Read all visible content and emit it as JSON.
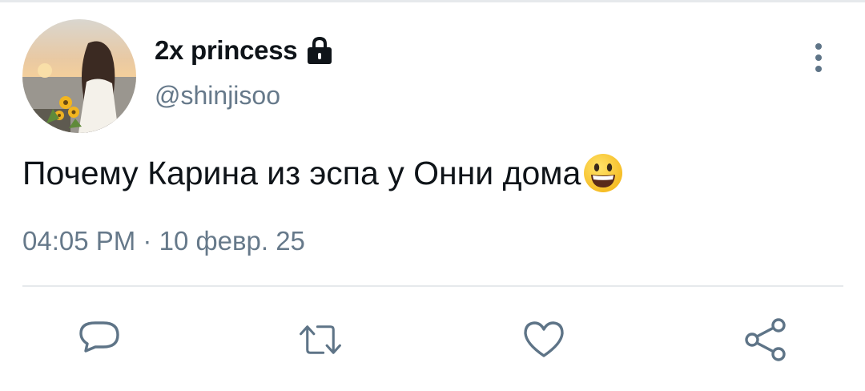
{
  "author": {
    "display_name": "2x princess",
    "handle": "@shinjisoo",
    "avatar": "avatar-photo-girl-sunflowers-sea",
    "lock_icon": "lock-icon"
  },
  "tweet": {
    "text": "Почему Карина из эспа у Онни дома",
    "emoji": "smiling-face-emoji",
    "time": "04:05 PM",
    "separator": "·",
    "date": "10 февр. 25"
  },
  "actions": [
    {
      "name": "reply",
      "icon": "reply-icon"
    },
    {
      "name": "retweet",
      "icon": "retweet-icon"
    },
    {
      "name": "like",
      "icon": "heart-icon"
    },
    {
      "name": "share",
      "icon": "share-icon"
    }
  ],
  "menu_icon": "more-vertical-icon",
  "colors": {
    "text_primary": "#0f1419",
    "text_secondary": "#66798a",
    "icon": "#5e7487",
    "divider": "#e6e9ec"
  }
}
